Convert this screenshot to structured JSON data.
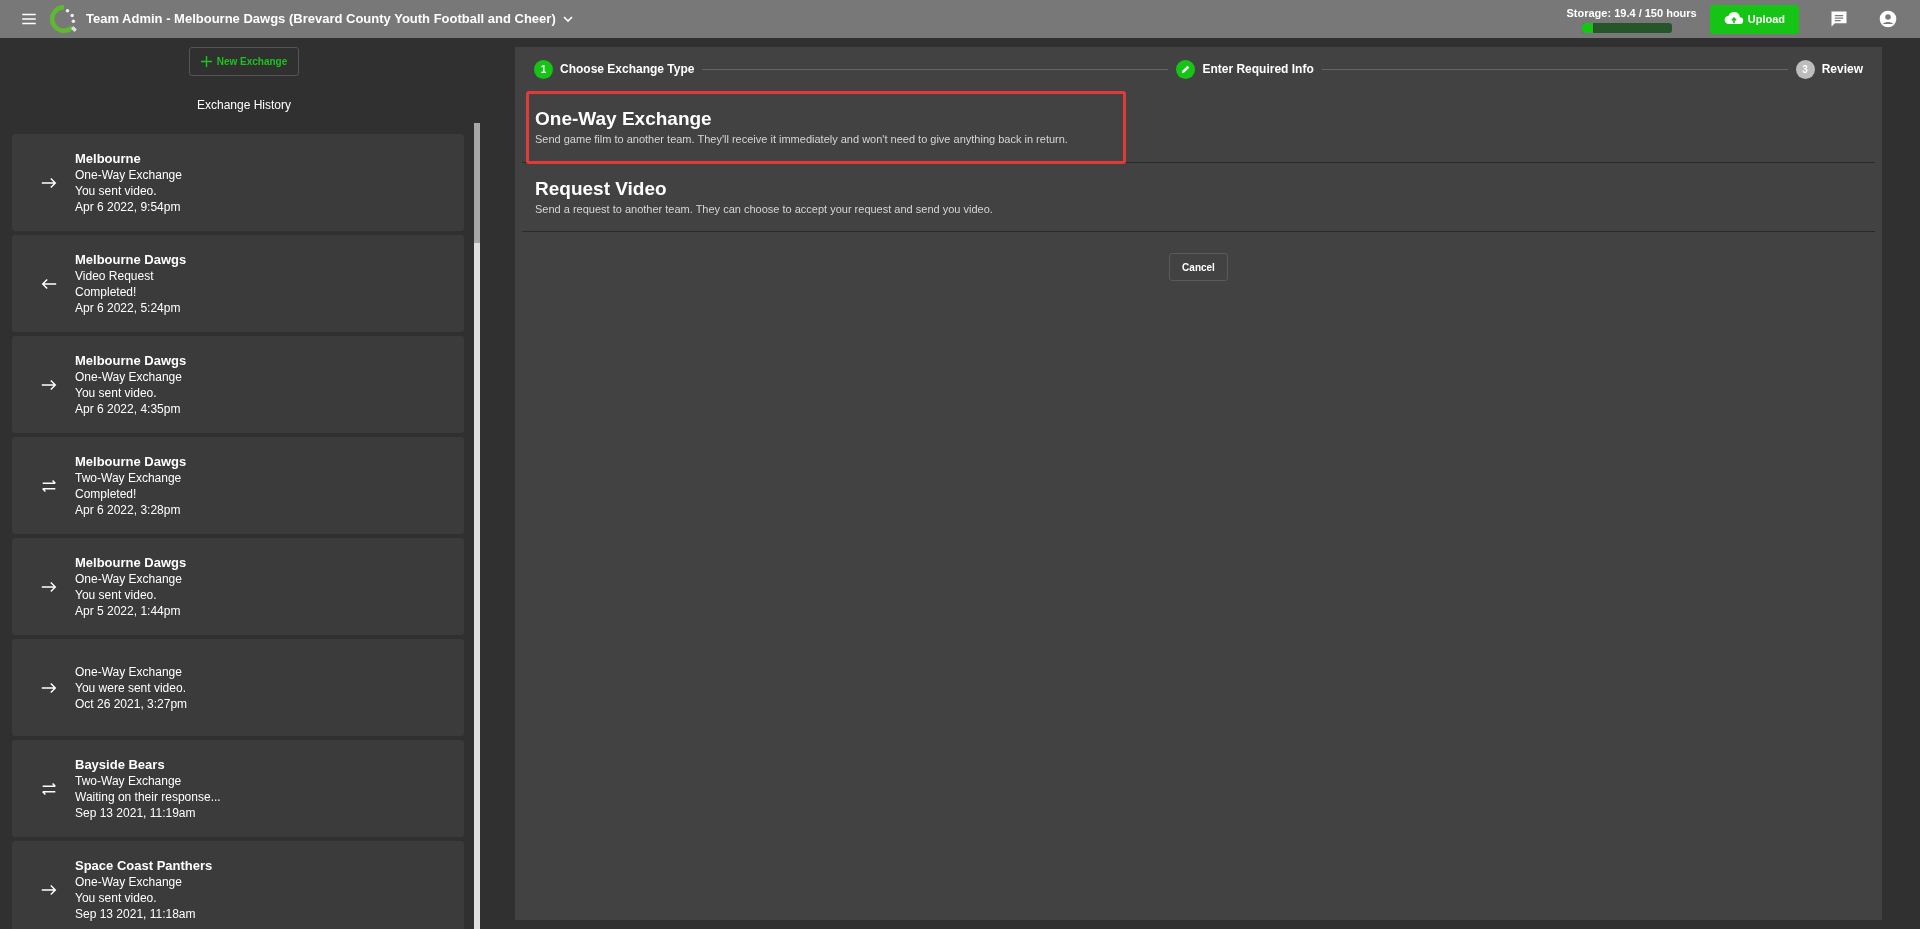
{
  "top_bar": {
    "title": "Team Admin - Melbourne Dawgs (Brevard County Youth Football and Cheer)",
    "storage": {
      "label": "Storage: 19.4 / 150 hours",
      "level": 0.13
    },
    "upload_button": "Upload"
  },
  "sidebar": {
    "new_button": "New Exchange",
    "heading": "Exchange History",
    "items": [
      {
        "kind": "outgoing",
        "team": "Melbourne",
        "type": "One-Way Exchange",
        "status": "You sent video.",
        "date": "Apr 6 2022, 9:54pm"
      },
      {
        "kind": "incoming",
        "team": "Melbourne Dawgs",
        "type": "Video Request",
        "status": "Completed!",
        "date": "Apr 6 2022, 5:24pm"
      },
      {
        "kind": "outgoing",
        "team": "Melbourne Dawgs",
        "type": "One-Way Exchange",
        "status": "You sent video.",
        "date": "Apr 6 2022, 4:35pm"
      },
      {
        "kind": "two-way",
        "team": "Melbourne Dawgs",
        "type": "Two-Way Exchange",
        "status": "Completed!",
        "date": "Apr 6 2022, 3:28pm"
      },
      {
        "kind": "outgoing",
        "team": "Melbourne Dawgs",
        "type": "One-Way Exchange",
        "status": "You sent video.",
        "date": "Apr 5 2022, 1:44pm"
      },
      {
        "kind": "outgoing",
        "type": "One-Way Exchange",
        "status": "You were sent video.",
        "date": "Oct 26 2021, 3:27pm"
      },
      {
        "kind": "two-way",
        "team": "Bayside Bears",
        "type": "Two-Way Exchange",
        "status": "Waiting on their response...",
        "date": "Sep 13 2021, 11:19am"
      },
      {
        "kind": "outgoing",
        "team": "Space Coast Panthers",
        "type": "One-Way Exchange",
        "status": "You sent video.",
        "date": "Sep 13 2021, 11:18am"
      }
    ]
  },
  "stepper": [
    {
      "kind": "current",
      "marker": "1",
      "label": "Choose Exchange Type"
    },
    {
      "kind": "edited",
      "label": "Enter Required Info"
    },
    {
      "kind": "pending",
      "marker": "3",
      "label": "Review"
    }
  ],
  "options": [
    {
      "title": "One-Way Exchange",
      "description": "Send game film to another team. They'll receive it immediately and won't need to give anything back in return.",
      "highlighted": true
    },
    {
      "title": "Request Video",
      "description": "Send a request to another team. They can choose to accept your request and send you video.",
      "highlighted": false
    }
  ],
  "cancel_button": "Cancel"
}
